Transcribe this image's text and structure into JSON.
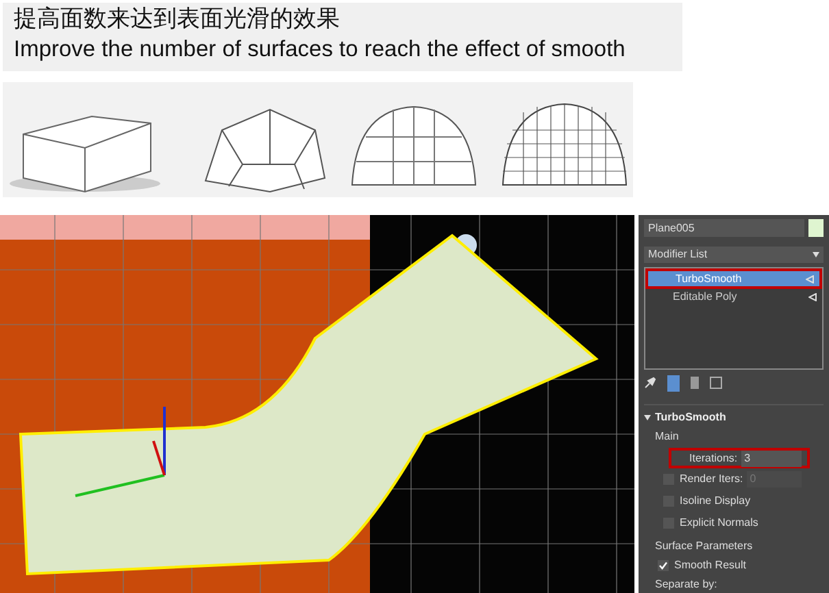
{
  "caption": {
    "title_zh": "提高面数来达到表面光滑的效果",
    "title_en": "Improve the number of surfaces to reach the effect of smooth"
  },
  "panel": {
    "object_name": "Plane005",
    "modifier_list": "Modifier List",
    "stack": [
      {
        "label": "TurboSmooth",
        "selected": true,
        "highlighted": true
      },
      {
        "label": "Editable Poly",
        "selected": false,
        "highlighted": false
      }
    ],
    "rollout_title": "TurboSmooth",
    "group_main": "Main",
    "iterations": {
      "label": "Iterations:",
      "value": "3"
    },
    "render_iters": {
      "label": "Render Iters:",
      "value": "0",
      "checked": false
    },
    "options": [
      {
        "label": "Isoline Display",
        "checked": false
      },
      {
        "label": "Explicit Normals",
        "checked": false
      }
    ],
    "group_surface": "Surface Parameters",
    "smooth_result": {
      "label": "Smooth Result",
      "checked": true
    },
    "separate_by": "Separate by:"
  }
}
